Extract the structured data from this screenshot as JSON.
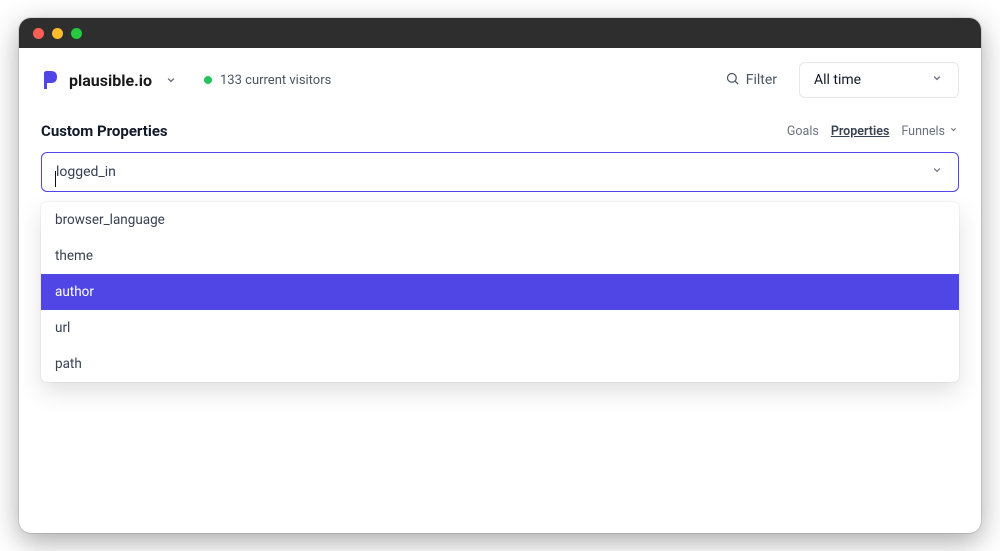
{
  "site": {
    "name": "plausible.io",
    "visitors_text": "133 current visitors"
  },
  "toolbar": {
    "filter_label": "Filter",
    "date_range_label": "All time"
  },
  "section": {
    "title": "Custom Properties"
  },
  "tabs": {
    "goals": "Goals",
    "properties": "Properties",
    "funnels": "Funnels"
  },
  "property_select": {
    "value": "logged_in",
    "options": [
      {
        "label": "browser_language",
        "selected": false
      },
      {
        "label": "theme",
        "selected": false
      },
      {
        "label": "author",
        "selected": true
      },
      {
        "label": "url",
        "selected": false
      },
      {
        "label": "path",
        "selected": false
      }
    ]
  }
}
